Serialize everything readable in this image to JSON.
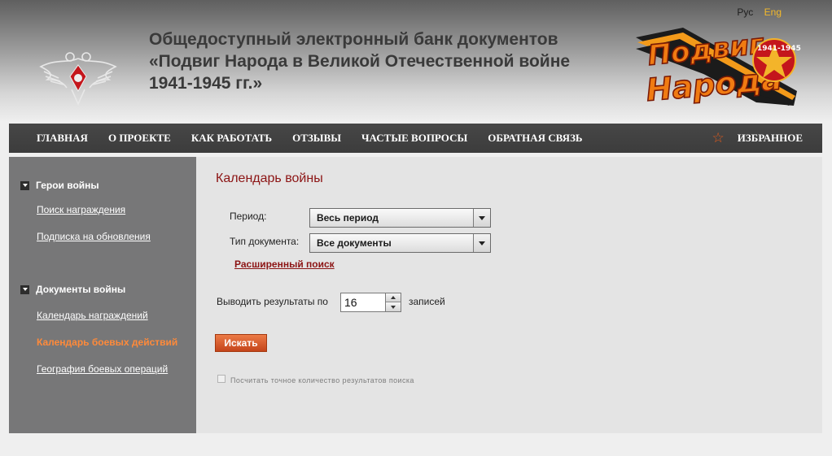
{
  "lang": {
    "ru": "Рус",
    "en": "Eng"
  },
  "header": {
    "title_line1": "Общедоступный электронный банк документов",
    "title_line2": "«Подвиг Народа в Великой Отечественной войне",
    "title_line3": "1941-1945 гг.»",
    "logo_top": "Подвиг",
    "logo_bottom": "Народа",
    "logo_badge": "1941-1945"
  },
  "nav": {
    "items": [
      "ГЛАВНАЯ",
      "О ПРОЕКТЕ",
      "КАК РАБОТАТЬ",
      "ОТЗЫВЫ",
      "ЧАСТЫЕ ВОПРОСЫ",
      "ОБРАТНАЯ СВЯЗЬ"
    ],
    "favorites": "ИЗБРАННОЕ",
    "favorites_icon": "star-icon"
  },
  "sidebar": {
    "heroes_heading": "Герои войны",
    "heroes_links": [
      "Поиск награждения",
      "Подписка на обновления"
    ],
    "docs_heading": "Документы войны",
    "docs_links": [
      "Календарь награждений",
      "Календарь боевых действий",
      "География боевых операций"
    ]
  },
  "main": {
    "title": "Календарь войны",
    "period_label": "Период:",
    "period_value": "Весь период",
    "doctype_label": "Тип документа:",
    "doctype_value": "Все документы",
    "advanced_search": "Расширенный поиск",
    "results_prefix": "Выводить результаты по",
    "results_value": "16",
    "results_suffix": "записей",
    "search_button": "Искать",
    "exact_count_label": "Посчитать точное количество результатов поиска"
  },
  "colors": {
    "accent": "#8c1414",
    "button": "#e0602c",
    "sidebar": "#777778",
    "nav": "#444444",
    "active_link": "#ff8a3a"
  }
}
